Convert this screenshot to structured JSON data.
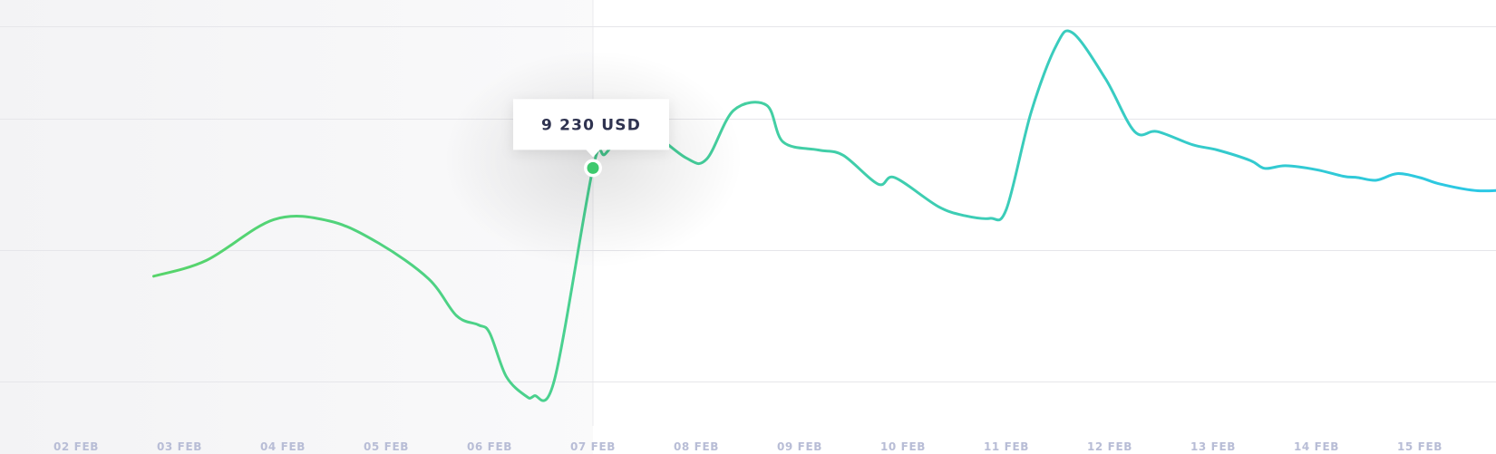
{
  "chart_data": {
    "type": "line",
    "x_ticks": [
      "02 FEB",
      "03 FEB",
      "04 FEB",
      "05 FEB",
      "06 FEB",
      "07 FEB",
      "08 FEB",
      "09 FEB",
      "10 FEB",
      "11 FEB",
      "12 FEB",
      "13 FEB",
      "14 FEB",
      "15 FEB"
    ],
    "series": [
      {
        "x": [
          0.75,
          1.26,
          1.91,
          2.45,
          2.93,
          3.41,
          3.68,
          3.89,
          4.0,
          4.16,
          4.35,
          4.43,
          4.63,
          5.0,
          5.12,
          5.34,
          5.51,
          5.9,
          6.1,
          6.36,
          6.68,
          6.84,
          7.18,
          7.42,
          7.76,
          7.92,
          8.34,
          8.6,
          8.84,
          9.0,
          9.24,
          9.48,
          9.64,
          9.96,
          10.24,
          10.46,
          10.8,
          11.04,
          11.36,
          11.5,
          11.7,
          12.0,
          12.26,
          12.4,
          12.58,
          12.78,
          13.0,
          13.2,
          13.56,
          14.0,
          14.3,
          14.45,
          14.7
        ],
        "values": [
          1000,
          2200,
          5300,
          5200,
          3500,
          800,
          -2000,
          -2700,
          -3300,
          -6600,
          -8100,
          -8100,
          -6800,
          9230,
          10300,
          12200,
          12300,
          10000,
          9900,
          13600,
          14000,
          11200,
          10600,
          10200,
          8000,
          8500,
          6300,
          5600,
          5400,
          6100,
          13500,
          18500,
          19500,
          16000,
          12000,
          12000,
          11000,
          10600,
          9800,
          9200,
          9400,
          9100,
          8600,
          8500,
          8300,
          8800,
          8500,
          8000,
          7500,
          7600,
          7300,
          6600,
          6500
        ],
        "color_start": "#5cd65c",
        "color_end": "#2bc8e6"
      }
    ],
    "ylim": [
      -9000,
      22000
    ],
    "grid_y": [
      -7000,
      3000,
      13000
    ],
    "grid": true,
    "highlight": {
      "x": 5.0,
      "value": 9230,
      "label": "9 230 USD"
    }
  }
}
